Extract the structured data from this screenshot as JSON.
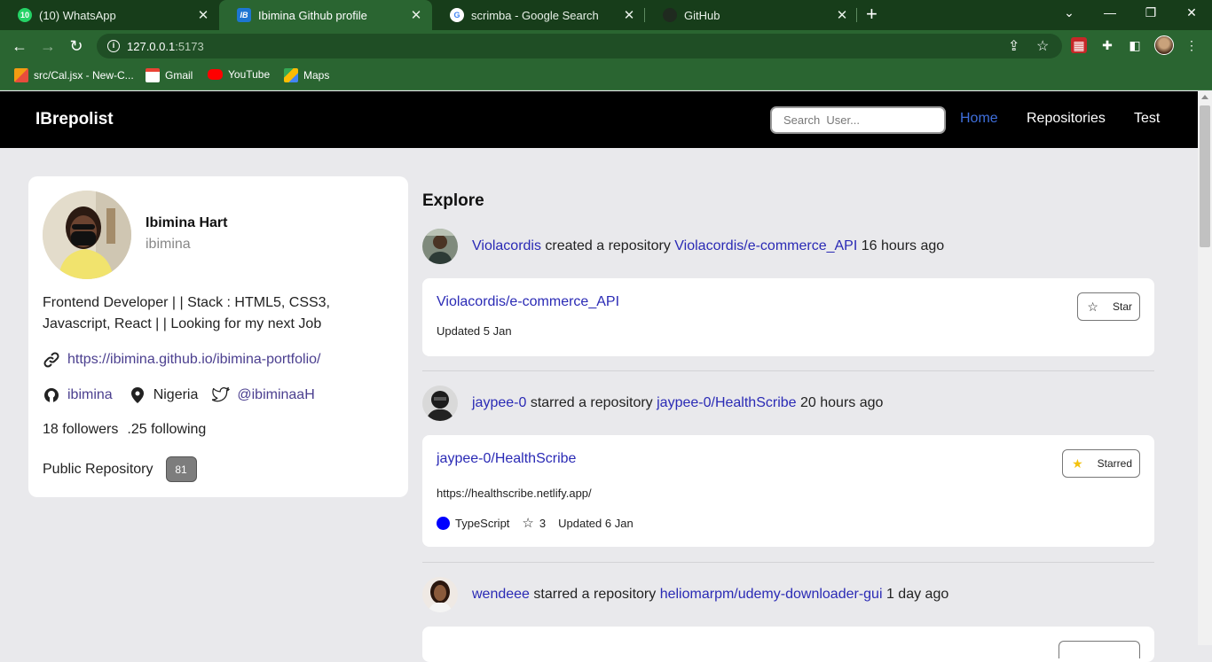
{
  "browser": {
    "tabs": [
      {
        "title": "(10) WhatsApp",
        "badge": "10"
      },
      {
        "title": "Ibimina Github profile",
        "badge": "IB"
      },
      {
        "title": "scrimba - Google Search",
        "badge": "G"
      },
      {
        "title": "GitHub",
        "badge": ""
      }
    ],
    "url_host": "127.0.0.1",
    "url_port": ":5173",
    "bookmarks": [
      {
        "label": "src/Cal.jsx - New-C..."
      },
      {
        "label": "Gmail"
      },
      {
        "label": "YouTube"
      },
      {
        "label": "Maps"
      }
    ]
  },
  "app": {
    "brand": "IBrepolist",
    "search_placeholder": "Search  User...",
    "nav": [
      "Home",
      "Repositories",
      "Test"
    ]
  },
  "profile": {
    "name": "Ibimina Hart",
    "login": "ibimina",
    "bio": "Frontend Developer | | Stack : HTML5, CSS3, Javascript, React | | Looking for my next Job",
    "website": "https://ibimina.github.io/ibimina-portfolio/",
    "github": "ibimina",
    "location": "Nigeria",
    "twitter": "@ibiminaaH",
    "followers": "18 followers",
    "following": ".25 following",
    "public_repo_label": "Public Repository",
    "public_repo_count": "81"
  },
  "explore": {
    "title": "Explore",
    "events": [
      {
        "user": "Violacordis",
        "action": "created a repository",
        "repo": "Violacordis/e-commerce_API",
        "time": "16 hours ago",
        "card": {
          "name": "Violacordis/e-commerce_API",
          "updated": "Updated 5 Jan",
          "button": "Star"
        }
      },
      {
        "user": "jaypee-0",
        "action": "starred a repository",
        "repo": "jaypee-0/HealthScribe",
        "time": "20 hours ago",
        "card": {
          "name": "jaypee-0/HealthScribe",
          "homepage": "https://healthscribe.netlify.app/",
          "language": "TypeScript",
          "stars": "3",
          "updated": "Updated 6 Jan",
          "button": "Starred"
        }
      },
      {
        "user": "wendeee",
        "action": "starred a repository",
        "repo": "heliomarpm/udemy-downloader-gui",
        "time": "1 day ago"
      }
    ]
  },
  "colors": {
    "chrome_dark": "#173d1a",
    "chrome": "#2a6531",
    "link": "#2a2ab5",
    "nav_active": "#3f6fdc",
    "language_dot": "#0000ff"
  }
}
